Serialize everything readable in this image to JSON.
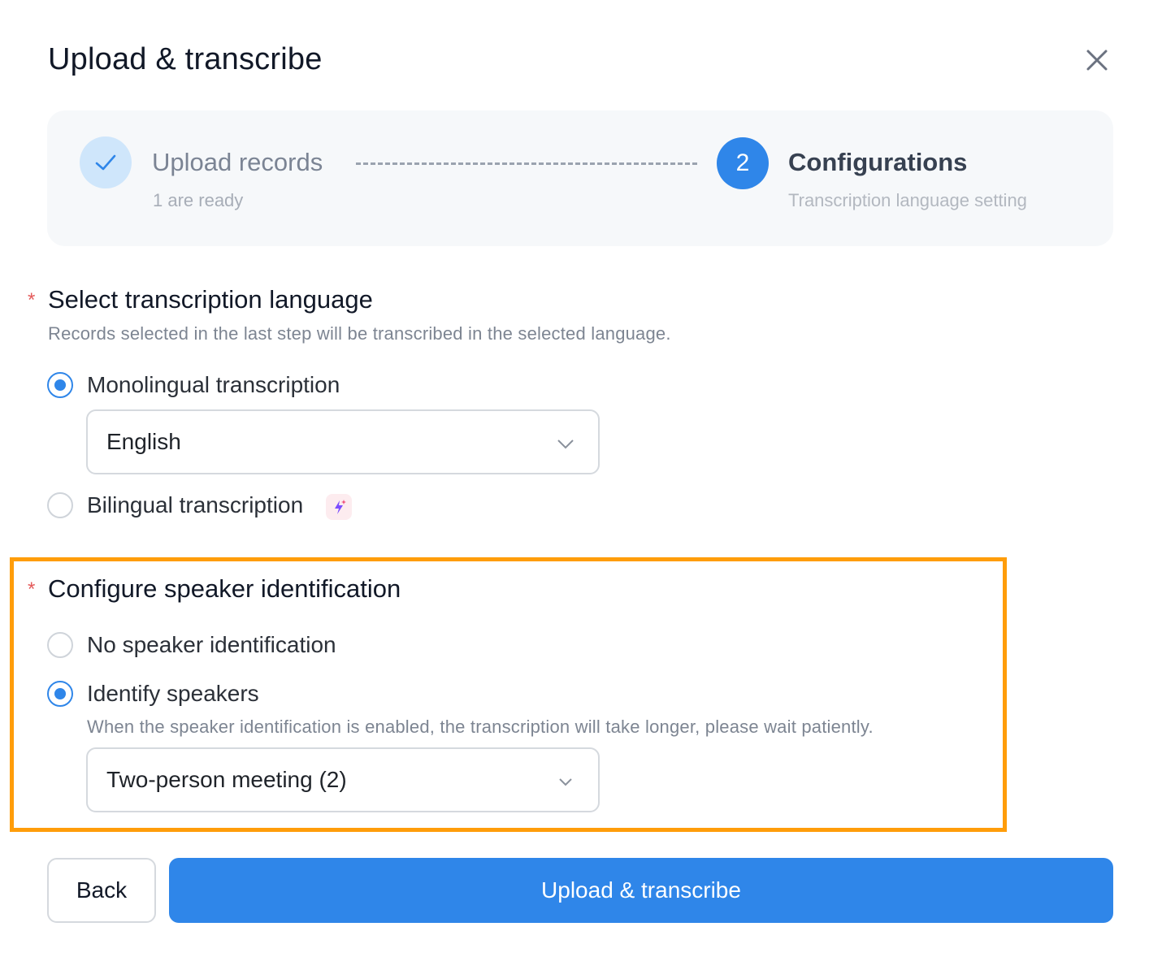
{
  "dialog": {
    "title": "Upload & transcribe",
    "close_icon": "close-icon"
  },
  "steps": [
    {
      "title": "Upload records",
      "subtitle": "1 are ready",
      "status": "done",
      "icon": "check-icon"
    },
    {
      "number": "2",
      "title": "Configurations",
      "subtitle": "Transcription language setting",
      "status": "active"
    }
  ],
  "language_section": {
    "required_mark": "*",
    "title": "Select transcription language",
    "description": "Records selected in the last step will be transcribed in the selected language.",
    "options": [
      {
        "label": "Monolingual transcription",
        "checked": true
      },
      {
        "label": "Bilingual transcription",
        "checked": false,
        "badge_icon": "ai-sparkle-icon"
      }
    ],
    "language_select": {
      "value": "English"
    }
  },
  "speaker_section": {
    "required_mark": "*",
    "title": "Configure speaker identification",
    "options": [
      {
        "label": "No speaker identification",
        "checked": false
      },
      {
        "label": "Identify speakers",
        "checked": true
      }
    ],
    "hint": "When the speaker identification is enabled, the transcription will take longer, please wait patiently.",
    "speaker_select": {
      "value": "Two-person meeting (2)"
    },
    "highlight_color": "#ff9d0a"
  },
  "footer": {
    "back_label": "Back",
    "submit_label": "Upload & transcribe"
  },
  "colors": {
    "primary": "#2f86e9",
    "required": "#e45a5a"
  }
}
